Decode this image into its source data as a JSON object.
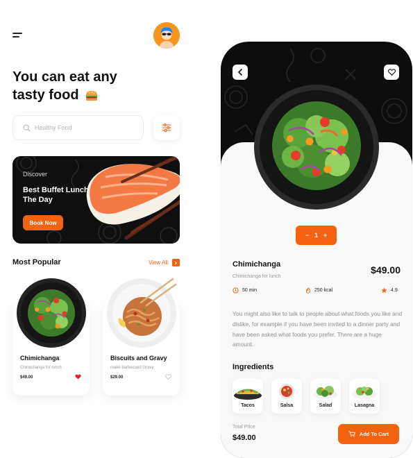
{
  "home": {
    "headline_line1": "You can eat any",
    "headline_line2": "tasty food",
    "search": {
      "placeholder": "Healthy Food"
    },
    "banner": {
      "eyebrow": "Discover",
      "title": "Best Buffet  Lunch Of The Day",
      "button_label": "Book Now"
    },
    "popular": {
      "title": "Most Popular",
      "view_all": "View All",
      "items": [
        {
          "name": "Chimichanga",
          "subtitle": "Chimichanga for lunch",
          "price": "$49.00",
          "favorite": true
        },
        {
          "name": "Biscuits and Gravy",
          "subtitle": "make barbecued Gravy",
          "price": "$29.00",
          "favorite": false
        }
      ]
    }
  },
  "detail": {
    "quantity": {
      "minus": "−",
      "value": "1",
      "plus": "+"
    },
    "name": "Chimichanga",
    "subtitle": "Chimichanga for lunch",
    "price": "$49.00",
    "time": "50 min",
    "calories": "250 kcal",
    "rating": "4.9",
    "description": "You might also like to talk to people about what foods you like and dislike, for example if you have been invited to a dinner party and have been asked what foods you prefer. There are a huge amount.",
    "ingredients_title": "Ingredients",
    "ingredients": [
      "Tacos",
      "Salsa",
      "Salad",
      "Lasagna"
    ],
    "total_label": "Total Price",
    "total_value": "$49.00",
    "cart_label": "Add To Cart"
  },
  "colors": {
    "accent": "#f2620f",
    "dark": "#0d0d0d",
    "favorite_red": "#e51d2a"
  },
  "icons": [
    "menu-icon",
    "avatar",
    "burger-icon",
    "search-icon",
    "filter-icon",
    "arrow-right-icon",
    "heart-icon",
    "back-arrow-icon",
    "clock-icon",
    "fire-icon",
    "star-icon",
    "cart-icon"
  ]
}
